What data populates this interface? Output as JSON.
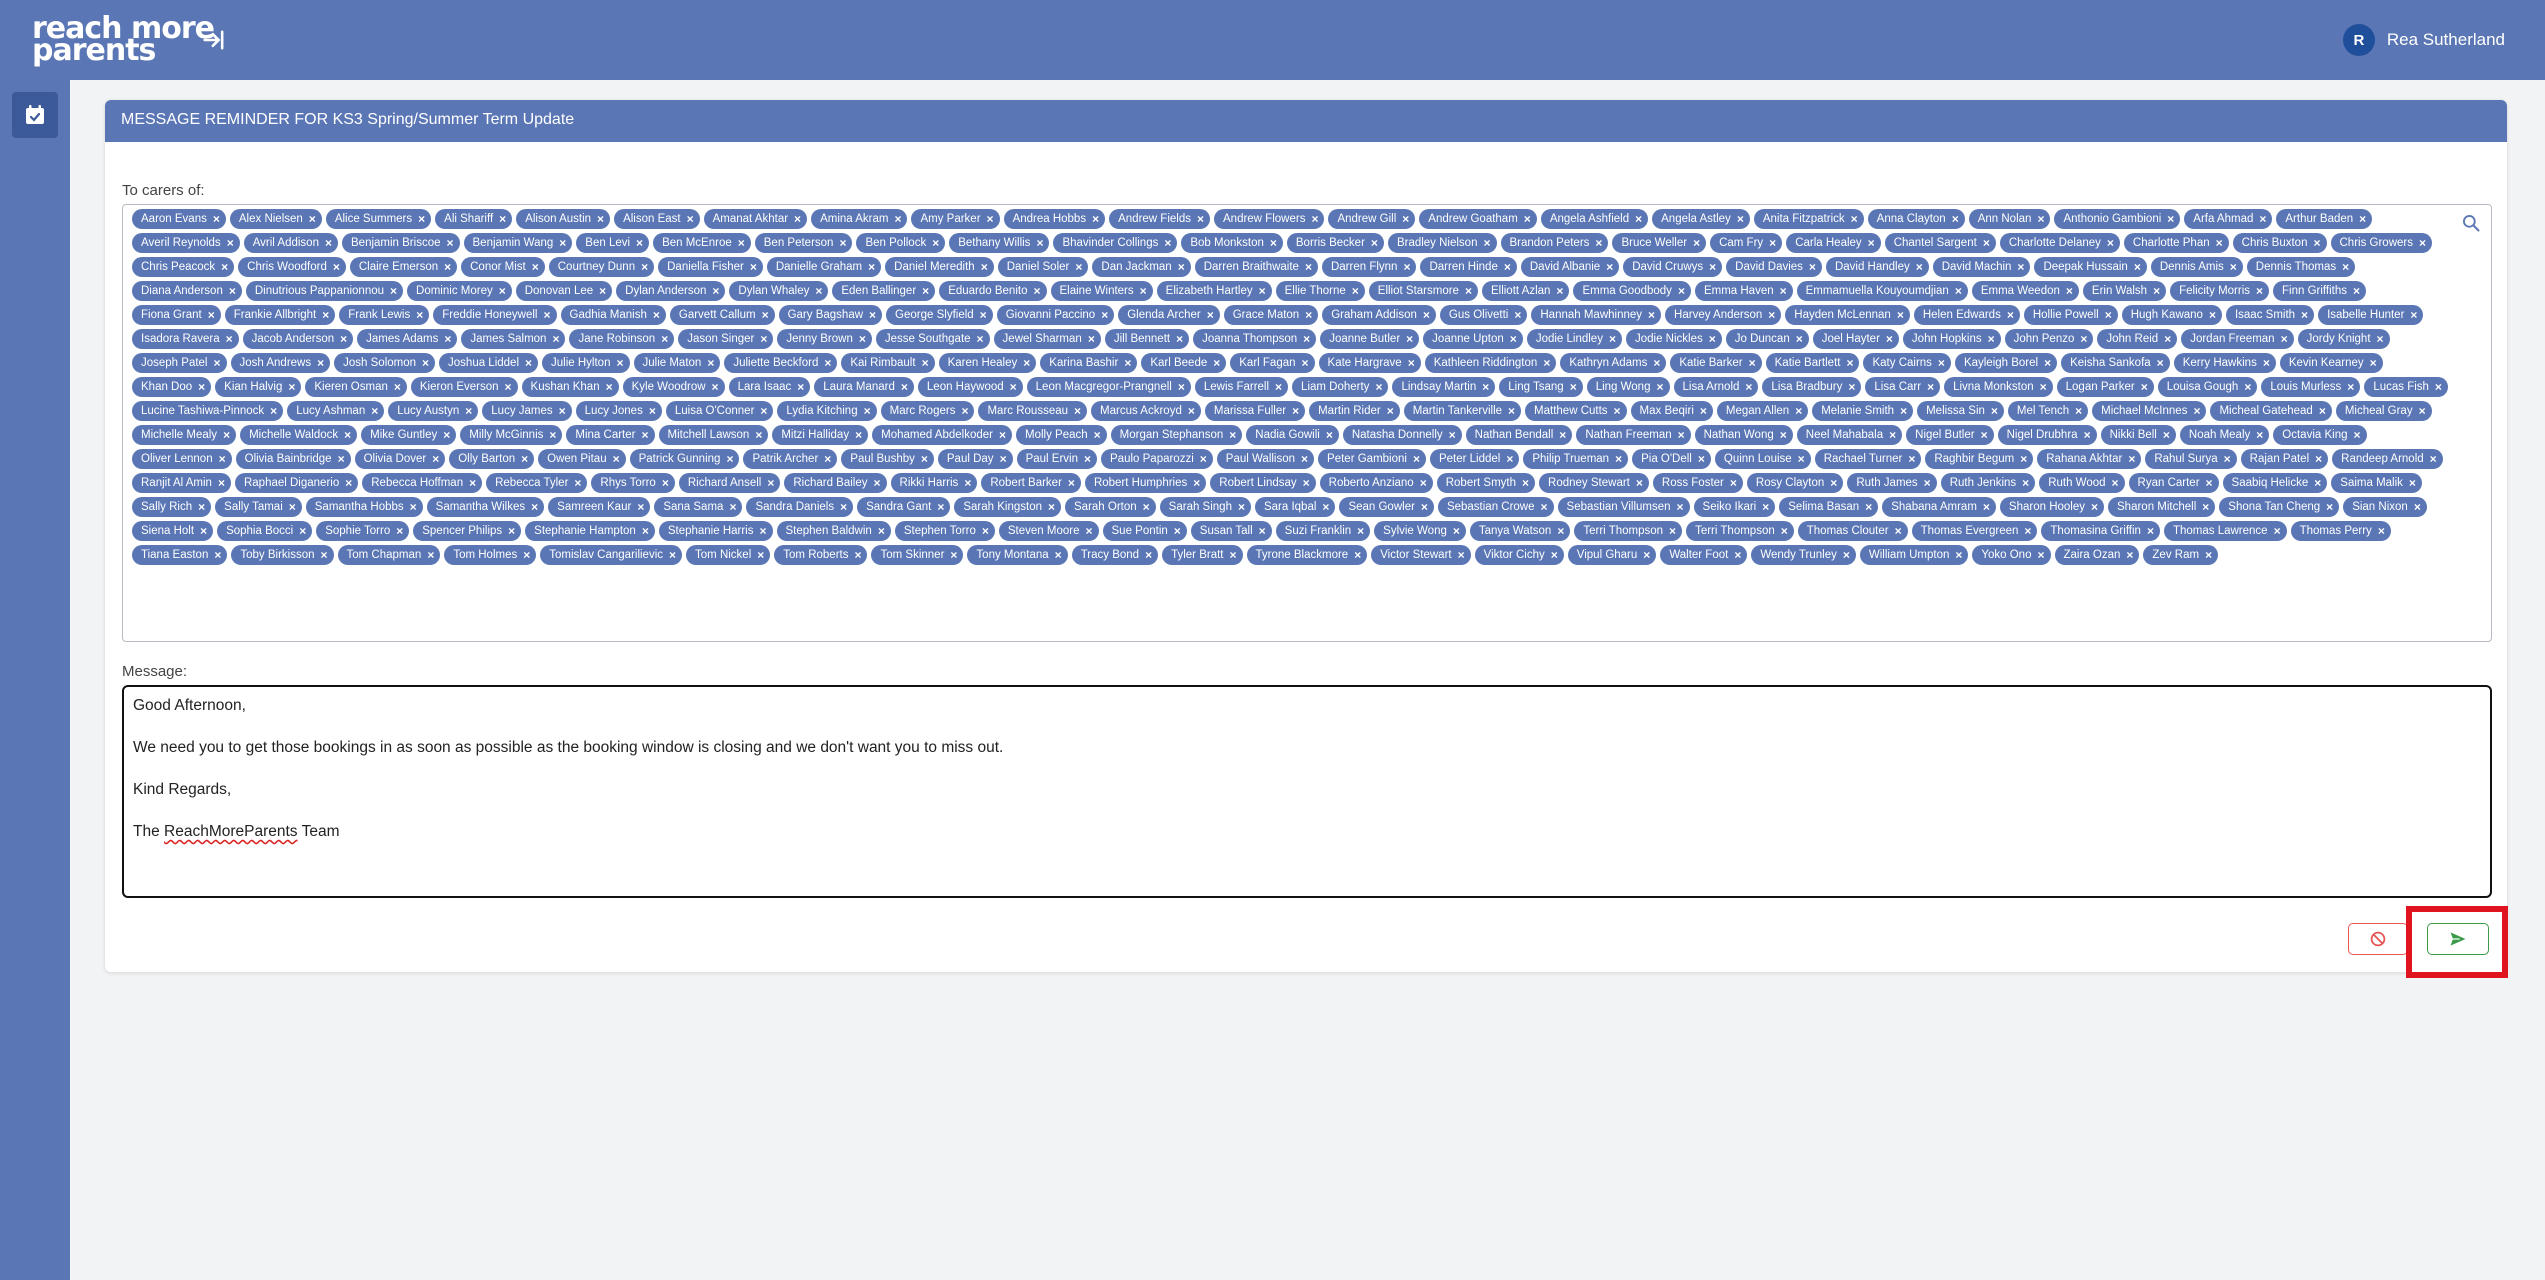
{
  "header": {
    "logo_line1": "reach more",
    "logo_line2": "parents",
    "user_initial": "R",
    "user_name": "Rea Sutherland"
  },
  "card": {
    "title": "MESSAGE REMINDER FOR KS3 Spring/Summer Term Update",
    "recipients_label": "To carers of:",
    "message_label": "Message:"
  },
  "recipients": [
    "Aaron Evans",
    "Alex Nielsen",
    "Alice Summers",
    "Ali Shariff",
    "Alison Austin",
    "Alison East",
    "Amanat Akhtar",
    "Amina Akram",
    "Amy Parker",
    "Andrea Hobbs",
    "Andrew Fields",
    "Andrew Flowers",
    "Andrew Gill",
    "Andrew Goatham",
    "Angela Ashfield",
    "Angela Astley",
    "Anita Fitzpatrick",
    "Anna Clayton",
    "Ann Nolan",
    "Anthonio Gambioni",
    "Arfa Ahmad",
    "Arthur Baden",
    "Averil Reynolds",
    "Avril Addison",
    "Benjamin Briscoe",
    "Benjamin Wang",
    "Ben Levi",
    "Ben McEnroe",
    "Ben Peterson",
    "Ben Pollock",
    "Bethany Willis",
    "Bhavinder Collings",
    "Bob Monkston",
    "Borris Becker",
    "Bradley Nielson",
    "Brandon Peters",
    "Bruce Weller",
    "Cam Fry",
    "Carla Healey",
    "Chantel Sargent",
    "Charlotte Delaney",
    "Charlotte Phan",
    "Chris Buxton",
    "Chris Growers",
    "Chris Peacock",
    "Chris Woodford",
    "Claire Emerson",
    "Conor Mist",
    "Courtney Dunn",
    "Daniella Fisher",
    "Danielle Graham",
    "Daniel Meredith",
    "Daniel Soler",
    "Dan Jackman",
    "Darren Braithwaite",
    "Darren Flynn",
    "Darren Hinde",
    "David Albanie",
    "David Cruwys",
    "David Davies",
    "David Handley",
    "David Machin",
    "Deepak Hussain",
    "Dennis Amis",
    "Dennis Thomas",
    "Diana Anderson",
    "Dinutrious Pappanionnou",
    "Dominic Morey",
    "Donovan Lee",
    "Dylan Anderson",
    "Dylan Whaley",
    "Eden Ballinger",
    "Eduardo Benito",
    "Elaine Winters",
    "Elizabeth Hartley",
    "Ellie Thorne",
    "Elliot Starsmore",
    "Elliott Azlan",
    "Emma Goodbody",
    "Emma Haven",
    "Emmamuella Kouyoumdjian",
    "Emma Weedon",
    "Erin Walsh",
    "Felicity Morris",
    "Finn Griffiths",
    "Fiona Grant",
    "Frankie Allbright",
    "Frank Lewis",
    "Freddie Honeywell",
    "Gadhia Manish",
    "Garvett Callum",
    "Gary Bagshaw",
    "George Slyfield",
    "Giovanni Paccino",
    "Glenda Archer",
    "Grace Maton",
    "Graham Addison",
    "Gus Olivetti",
    "Hannah Mawhinney",
    "Harvey Anderson",
    "Hayden McLennan",
    "Helen Edwards",
    "Hollie Powell",
    "Hugh Kawano",
    "Isaac Smith",
    "Isabelle Hunter",
    "Isadora Ravera",
    "Jacob Anderson",
    "James Adams",
    "James Salmon",
    "Jane Robinson",
    "Jason Singer",
    "Jenny Brown",
    "Jesse Southgate",
    "Jewel Sharman",
    "Jill Bennett",
    "Joanna Thompson",
    "Joanne Butler",
    "Joanne Upton",
    "Jodie Lindley",
    "Jodie Nickles",
    "Jo Duncan",
    "Joel Hayter",
    "John Hopkins",
    "John Penzo",
    "John Reid",
    "Jordan Freeman",
    "Jordy Knight",
    "Joseph Patel",
    "Josh Andrews",
    "Josh Solomon",
    "Joshua Liddel",
    "Julie Hylton",
    "Julie Maton",
    "Juliette Beckford",
    "Kai Rimbault",
    "Karen Healey",
    "Karina Bashir",
    "Karl Beede",
    "Karl Fagan",
    "Kate Hargrave",
    "Kathleen Riddington",
    "Kathryn Adams",
    "Katie Barker",
    "Katie Bartlett",
    "Katy Cairns",
    "Kayleigh Borel",
    "Keisha Sankofa",
    "Kerry Hawkins",
    "Kevin Kearney",
    "Khan Doo",
    "Kian Halvig",
    "Kieren Osman",
    "Kieron Everson",
    "Kushan Khan",
    "Kyle Woodrow",
    "Lara Isaac",
    "Laura Manard",
    "Leon Haywood",
    "Leon Macgregor-Prangnell",
    "Lewis Farrell",
    "Liam Doherty",
    "Lindsay Martin",
    "Ling Tsang",
    "Ling Wong",
    "Lisa Arnold",
    "Lisa Bradbury",
    "Lisa Carr",
    "Livna Monkston",
    "Logan Parker",
    "Louisa Gough",
    "Louis Murless",
    "Lucas Fish",
    "Lucine Tashiwa-Pinnock",
    "Lucy Ashman",
    "Lucy Austyn",
    "Lucy James",
    "Lucy Jones",
    "Luisa O'Conner",
    "Lydia Kitching",
    "Marc Rogers",
    "Marc Rousseau",
    "Marcus Ackroyd",
    "Marissa Fuller",
    "Martin Rider",
    "Martin Tankerville",
    "Matthew Cutts",
    "Max Beqiri",
    "Megan Allen",
    "Melanie Smith",
    "Melissa Sin",
    "Mel Tench",
    "Michael McInnes",
    "Micheal Gatehead",
    "Micheal Gray",
    "Michelle Mealy",
    "Michelle Waldock",
    "Mike Guntley",
    "Milly McGinnis",
    "Mina Carter",
    "Mitchell Lawson",
    "Mitzi Halliday",
    "Mohamed Abdelkoder",
    "Molly Peach",
    "Morgan Stephanson",
    "Nadia Gowili",
    "Natasha Donnelly",
    "Nathan Bendall",
    "Nathan Freeman",
    "Nathan Wong",
    "Neel Mahabala",
    "Nigel Butler",
    "Nigel Drubhra",
    "Nikki Bell",
    "Noah Mealy",
    "Octavia King",
    "Oliver Lennon",
    "Olivia Bainbridge",
    "Olivia Dover",
    "Olly Barton",
    "Owen Pitau",
    "Patrick Gunning",
    "Patrik Archer",
    "Paul Bushby",
    "Paul Day",
    "Paul Ervin",
    "Paulo Paparozzi",
    "Paul Wallison",
    "Peter Gambioni",
    "Peter Liddel",
    "Philip Trueman",
    "Pia O'Dell",
    "Quinn Louise",
    "Rachael Turner",
    "Raghbir Begum",
    "Rahana Akhtar",
    "Rahul Surya",
    "Rajan Patel",
    "Randeep Arnold",
    "Ranjit Al Amin",
    "Raphael Diganerio",
    "Rebecca Hoffman",
    "Rebecca Tyler",
    "Rhys Torro",
    "Richard Ansell",
    "Richard Bailey",
    "Rikki Harris",
    "Robert Barker",
    "Robert Humphries",
    "Robert Lindsay",
    "Roberto Anziano",
    "Robert Smyth",
    "Rodney Stewart",
    "Ross Foster",
    "Rosy Clayton",
    "Ruth James",
    "Ruth Jenkins",
    "Ruth Wood",
    "Ryan Carter",
    "Saabiq Helicke",
    "Saima Malik",
    "Sally Rich",
    "Sally Tamai",
    "Samantha Hobbs",
    "Samantha Wilkes",
    "Samreen Kaur",
    "Sana Sama",
    "Sandra Daniels",
    "Sandra Gant",
    "Sarah Kingston",
    "Sarah Orton",
    "Sarah Singh",
    "Sara Iqbal",
    "Sean Gowler",
    "Sebastian Crowe",
    "Sebastian Villumsen",
    "Seiko Ikari",
    "Selima Basan",
    "Shabana Amram",
    "Sharon Hooley",
    "Sharon Mitchell",
    "Shona Tan Cheng",
    "Sian Nixon",
    "Siena Holt",
    "Sophia Bocci",
    "Sophie Torro",
    "Spencer Philips",
    "Stephanie Hampton",
    "Stephanie Harris",
    "Stephen Baldwin",
    "Stephen Torro",
    "Steven Moore",
    "Sue Pontin",
    "Susan Tall",
    "Suzi Franklin",
    "Sylvie Wong",
    "Tanya Watson",
    "Terri Thompson",
    "Terri Thompson",
    "Thomas Clouter",
    "Thomas Evergreen",
    "Thomasina Griffin",
    "Thomas Lawrence",
    "Thomas Perry",
    "Tiana Easton",
    "Toby Birkisson",
    "Tom Chapman",
    "Tom Holmes",
    "Tomislav Cangarilievic",
    "Tom Nickel",
    "Tom Roberts",
    "Tom Skinner",
    "Tony Montana",
    "Tracy Bond",
    "Tyler Bratt",
    "Tyrone Blackmore",
    "Victor Stewart",
    "Viktor Cichy",
    "Vipul Gharu",
    "Walter Foot",
    "Wendy Trunley",
    "William Umpton",
    "Yoko Ono",
    "Zaira Ozan",
    "Zev Ram"
  ],
  "message": {
    "greeting": "Good Afternoon,",
    "body": "We need you to get those bookings in as soon as possible as the booking window is closing and we don't want you to miss out.",
    "closing": "Kind Regards,",
    "signature_prefix": "The ",
    "signature_brand": "ReachMoreParents",
    "signature_suffix": " Team"
  },
  "colors": {
    "brand": "#5a76b4",
    "cancel": "#e55555",
    "send": "#3a9a4a",
    "highlight": "#e0141e"
  },
  "icons": {
    "collapse": "arrow-to-right-icon",
    "calendar": "calendar-check-icon",
    "search": "search-icon",
    "cancel": "ban-icon",
    "send": "send-icon",
    "chip_remove": "×"
  }
}
